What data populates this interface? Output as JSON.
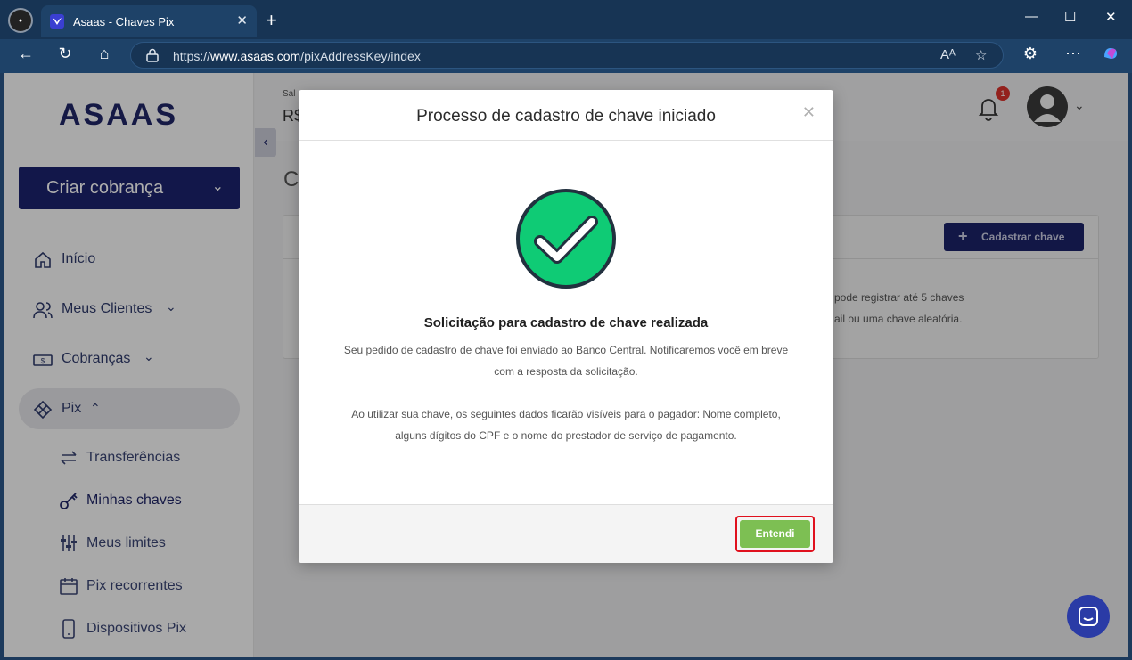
{
  "browser": {
    "tab_title": "Asaas - Chaves Pix",
    "url_prefix": "https://",
    "url_domain": "www.asaas.com",
    "url_path": "/pixAddressKey/index"
  },
  "sidebar": {
    "logo": "ASAAS",
    "create_button": "Criar cobrança",
    "items": [
      {
        "label": "Início"
      },
      {
        "label": "Meus Clientes"
      },
      {
        "label": "Cobranças"
      },
      {
        "label": "Pix"
      }
    ],
    "pix_subitems": [
      {
        "label": "Transferências"
      },
      {
        "label": "Minhas chaves"
      },
      {
        "label": "Meus limites"
      },
      {
        "label": "Pix recorrentes"
      },
      {
        "label": "Dispositivos Pix"
      }
    ]
  },
  "header": {
    "saldo_label": "Sal",
    "saldo_value": "R$",
    "notifications_count": "1"
  },
  "main": {
    "title": "C",
    "register_button": "Cadastrar chave",
    "info_line1": "pode registrar até 5 chaves",
    "info_line2": "ail ou uma chave aleatória."
  },
  "modal": {
    "title": "Processo de cadastro de chave iniciado",
    "subtitle": "Solicitação para cadastro de chave realizada",
    "p1_line1": "Seu pedido de cadastro de chave foi enviado ao Banco Central. Notificaremos você em breve",
    "p1_line2": "com a resposta da solicitação.",
    "p2_line1": "Ao utilizar sua chave, os seguintes dados ficarão visíveis para o pagador: Nome completo,",
    "p2_line2": "alguns dígitos do CPF e o nome do prestador de serviço de pagamento.",
    "ok_button": "Entendi"
  },
  "colors": {
    "brand": "#1b236d",
    "success": "#0fcb75",
    "ok_button": "#7dbf53",
    "highlight": "#e0101d"
  }
}
